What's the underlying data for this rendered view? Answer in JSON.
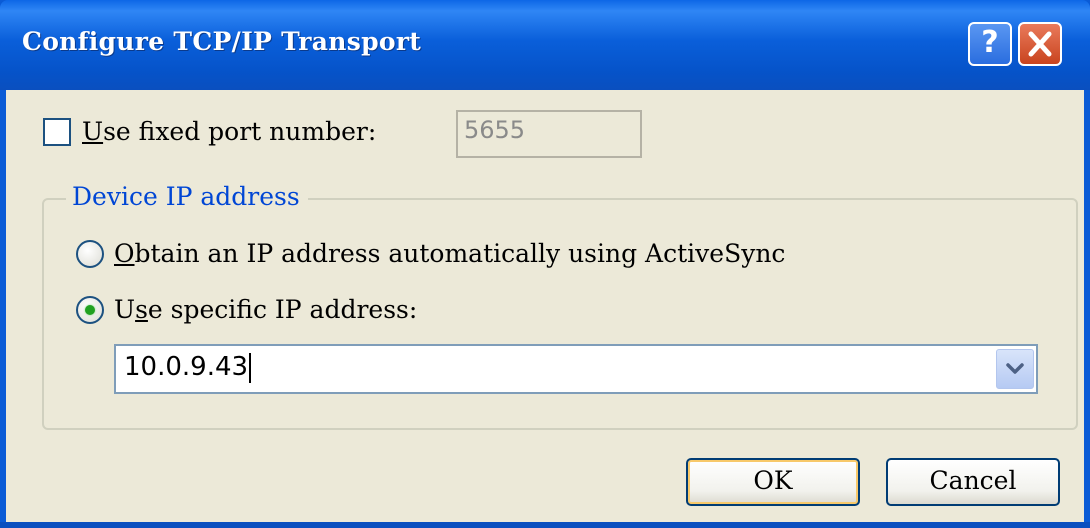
{
  "window": {
    "title": "Configure TCP/IP Transport"
  },
  "titlebar": {
    "help_label": "?"
  },
  "port": {
    "checkbox_checked": false,
    "label_mnemonic": "U",
    "label_rest": "se fixed port number:",
    "value": "5655",
    "enabled": false
  },
  "group": {
    "title": "Device IP address",
    "radio_auto": {
      "mnemonic": "O",
      "rest": "btain an IP address automatically using ActiveSync",
      "selected": false
    },
    "radio_specific": {
      "prefix": "U",
      "mnemonic": "s",
      "rest": "e specific IP address:",
      "selected": true
    },
    "ip_value": "10.0.9.43"
  },
  "buttons": {
    "ok": "OK",
    "cancel": "Cancel"
  },
  "colors": {
    "titlebar": "#0a5fda",
    "dialog_bg": "#ece9d8",
    "group_title": "#0046d5",
    "radio_dot": "#21a121"
  }
}
